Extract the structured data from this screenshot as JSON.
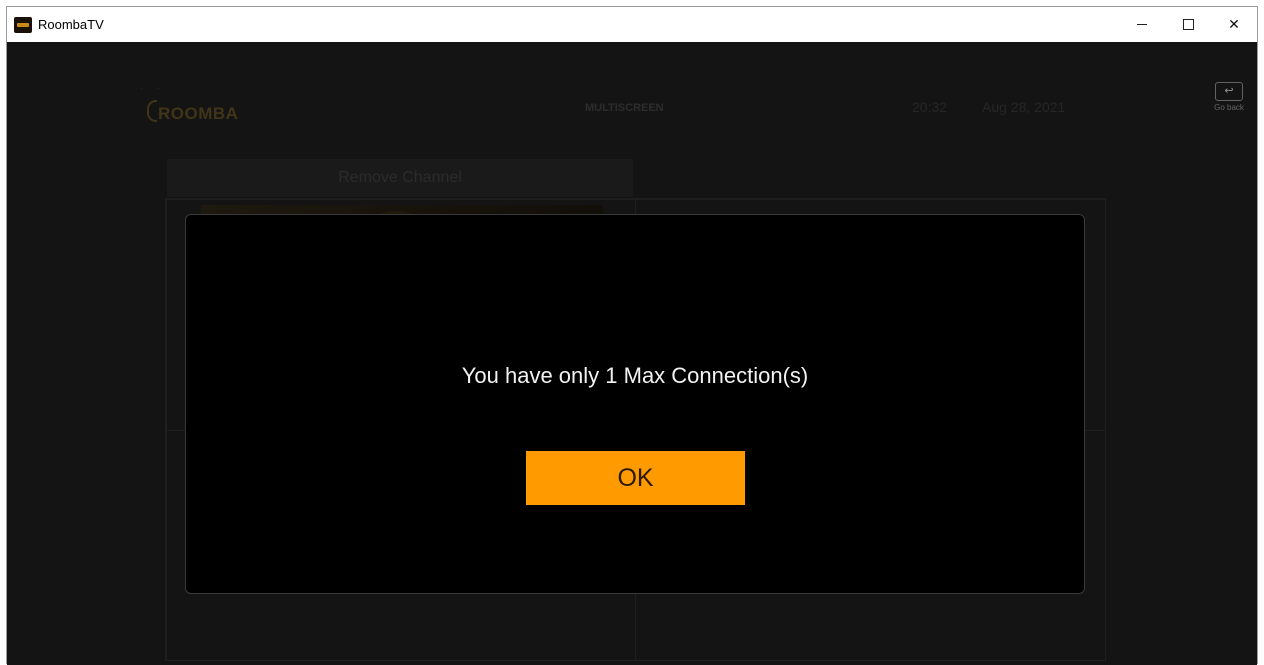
{
  "window": {
    "title": "RoombaTV",
    "controls": {
      "minimize": "",
      "maximize": "",
      "close": "✕"
    }
  },
  "header": {
    "logo_text": "ROOMBA",
    "page_title": "MULTISCREEN",
    "time": "20:32",
    "date": "Aug 28, 2021",
    "go_back_icon": "↩",
    "go_back_label": "Go back"
  },
  "multiscreen": {
    "remove_channel_label": "Remove Channel",
    "add_icon": "+"
  },
  "dialog": {
    "message": "You have only 1 Max Connection(s)",
    "ok_label": "OK"
  },
  "colors": {
    "accent": "#ff9a00",
    "background": "#1c1c1c",
    "dialog_background": "#000000"
  }
}
